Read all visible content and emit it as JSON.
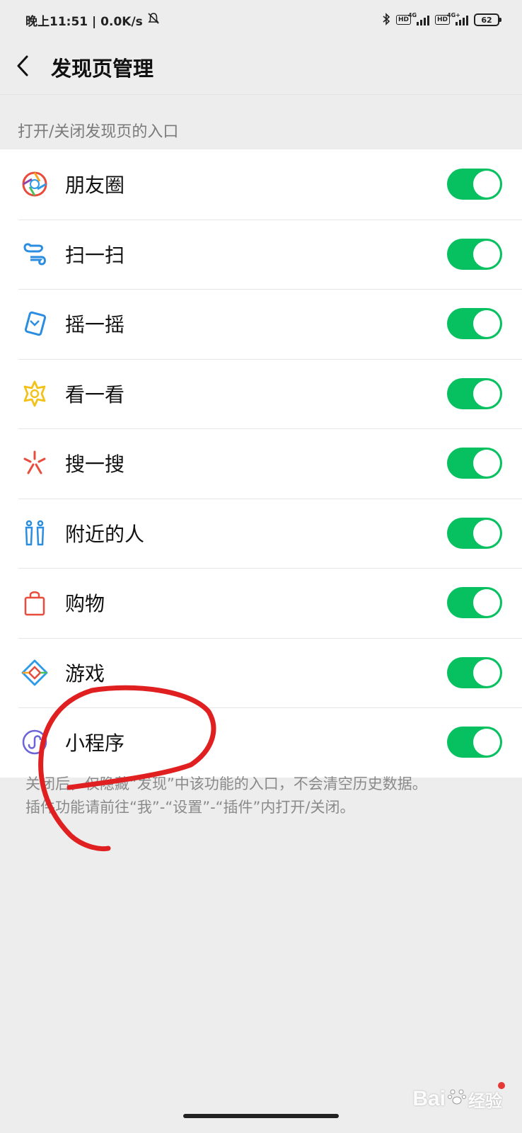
{
  "status_bar": {
    "time_speed": "晚上11:51 | 0.0K/s",
    "net1": "4G",
    "net2": "4G+",
    "hd": "HD",
    "battery": "62"
  },
  "header": {
    "title": "发现页管理"
  },
  "section": {
    "title": "打开/关闭发现页的入口"
  },
  "items": [
    {
      "label": "朋友圈",
      "icon": "moments-icon",
      "on": true
    },
    {
      "label": "扫一扫",
      "icon": "scan-icon",
      "on": true
    },
    {
      "label": "摇一摇",
      "icon": "shake-icon",
      "on": true
    },
    {
      "label": "看一看",
      "icon": "top-stories-icon",
      "on": true
    },
    {
      "label": "搜一搜",
      "icon": "search-sparkle-icon",
      "on": true
    },
    {
      "label": "附近的人",
      "icon": "people-nearby-icon",
      "on": true
    },
    {
      "label": "购物",
      "icon": "shopping-bag-icon",
      "on": true
    },
    {
      "label": "游戏",
      "icon": "games-icon",
      "on": true
    },
    {
      "label": "小程序",
      "icon": "mini-programs-icon",
      "on": true
    }
  ],
  "footer": {
    "line1": "关闭后，仅隐藏“发现”中该功能的入口，不会清空历史数据。",
    "line2": "插件功能请前往“我”-“设置”-“插件”内打开/关闭。"
  },
  "watermark": {
    "text_latin": "Bai",
    "text_cn": "经验"
  },
  "colors": {
    "toggle_on": "#07c160",
    "background": "#ededed",
    "annotation": "#e02020"
  }
}
